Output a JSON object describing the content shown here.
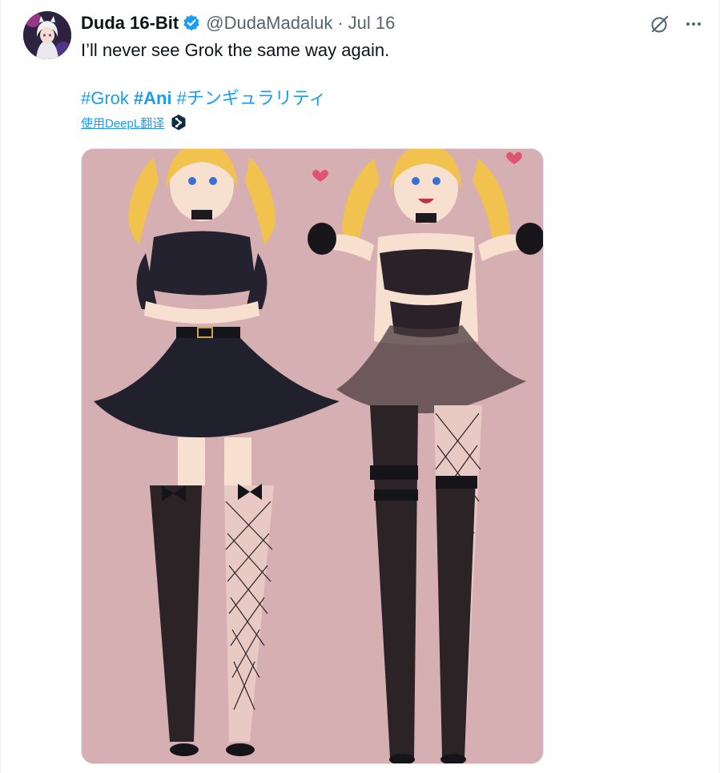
{
  "tweet": {
    "author": {
      "display_name": "Duda 16-Bit",
      "verified": true,
      "handle": "@DudaMadaluk",
      "avatar_icon": "anime-avatar"
    },
    "separator": "·",
    "date": "Jul 16",
    "text": "I’ll never see Grok the same way again.",
    "hashtags": [
      {
        "label": "#Grok",
        "bold": false
      },
      {
        "label": "#Ani",
        "bold": true
      },
      {
        "label": "#チンギュラリティ",
        "bold": false
      }
    ],
    "translate_label": "使用DeepL翻译",
    "translate_icon": "deepl-icon",
    "media": {
      "type": "image",
      "icon": "anime-illustration"
    },
    "actions": {
      "grok_icon": "grok-icon",
      "more_icon": "more-icon"
    }
  },
  "colors": {
    "accent": "#1d9bf0",
    "text_primary": "#0f1419",
    "text_secondary": "#536471",
    "image_background": "#d6afb2"
  }
}
